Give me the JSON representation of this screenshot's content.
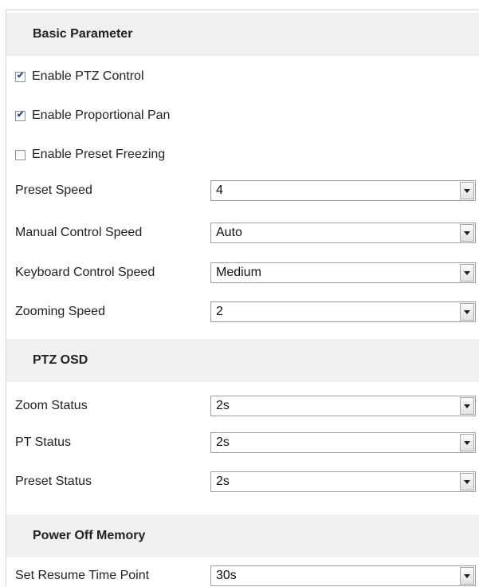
{
  "sections": {
    "basic": {
      "title": "Basic Parameter",
      "checkboxes": [
        {
          "label": "Enable PTZ Control",
          "checked": true
        },
        {
          "label": "Enable Proportional Pan",
          "checked": true
        },
        {
          "label": "Enable Preset Freezing",
          "checked": false
        }
      ],
      "fields": [
        {
          "label": "Preset Speed",
          "value": "4"
        },
        {
          "label": "Manual Control Speed",
          "value": "Auto"
        },
        {
          "label": "Keyboard Control Speed",
          "value": "Medium"
        },
        {
          "label": "Zooming Speed",
          "value": "2"
        }
      ]
    },
    "osd": {
      "title": "PTZ OSD",
      "fields": [
        {
          "label": "Zoom Status",
          "value": "2s"
        },
        {
          "label": "PT Status",
          "value": "2s"
        },
        {
          "label": "Preset Status",
          "value": "2s"
        }
      ]
    },
    "power": {
      "title": "Power Off Memory",
      "fields": [
        {
          "label": "Set Resume Time Point",
          "value": "30s"
        }
      ]
    }
  },
  "icons": {
    "checkbox_tick": "checkmark-icon",
    "dropdown": "chevron-down-icon"
  },
  "colors": {
    "section_header_bg": "#f0f0f0",
    "checkmark": "#2b4a8c"
  }
}
